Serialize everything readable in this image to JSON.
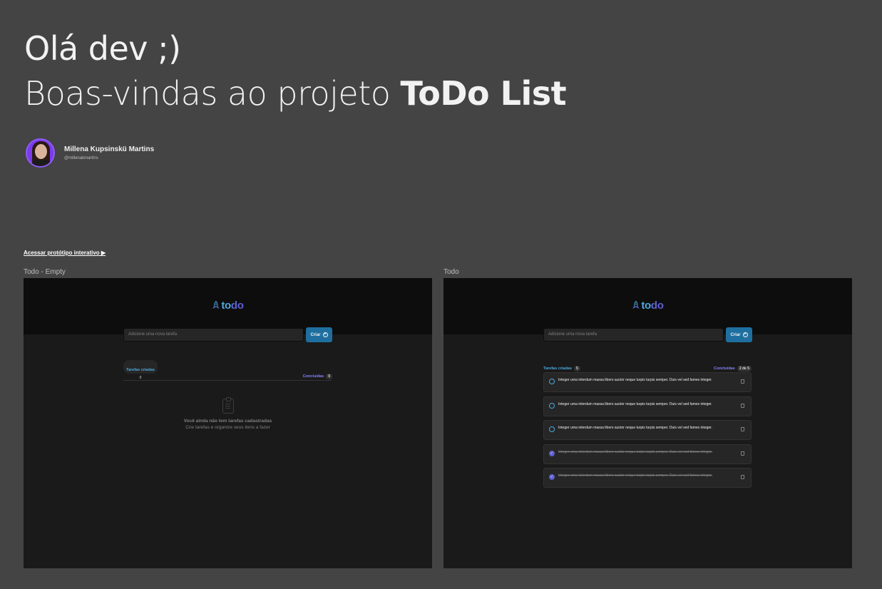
{
  "header": {
    "greeting": "Olá dev ;)",
    "welcome_prefix": "Boas-vindas ao projeto",
    "welcome_project": "ToDo List"
  },
  "author": {
    "name": "Millena Kupsinskü Martins",
    "handle": "@millenakmartins"
  },
  "prototype_link": "Acessar protótipo interativo ▶",
  "frames": {
    "empty": {
      "label": "Todo - Empty",
      "logo_to": "to",
      "logo_do": "do",
      "input_placeholder": "Adicione uma nova tarefa",
      "create_label": "Criar",
      "created_label": "Tarefas criadas",
      "created_count": "0",
      "done_label": "Concluídas",
      "done_count": "0",
      "empty_title": "Você ainda não tem tarefas cadastradas",
      "empty_subtitle": "Crie tarefas e organize seus itens a fazer"
    },
    "list": {
      "label": "Todo",
      "logo_to": "to",
      "logo_do": "do",
      "input_placeholder": "Adicione uma nova tarefa",
      "create_label": "Criar",
      "created_label": "Tarefas criadas",
      "created_count": "5",
      "done_label": "Concluídas",
      "done_count": "2 de 5",
      "tasks": [
        {
          "text": "Integer urna interdum massa libero auctor neque turpis turpis semper. Duis vel sed fames integer.",
          "done": false
        },
        {
          "text": "Integer urna interdum massa libero auctor neque turpis turpis semper. Duis vel sed fames integer.",
          "done": false
        },
        {
          "text": "Integer urna interdum massa libero auctor neque turpis turpis semper. Duis vel sed fames integer.",
          "done": false
        },
        {
          "text": "Integer urna interdum massa libero auctor neque turpis turpis semper. Duis vel sed fames integer.",
          "done": true
        },
        {
          "text": "Integer urna interdum massa libero auctor neque turpis turpis semper. Duis vel sed fames integer.",
          "done": true
        }
      ]
    }
  },
  "colors": {
    "page_bg": "#444444",
    "app_bg": "#1a1a1a",
    "header_bg": "#0d0d0d",
    "blue": "#4ea8de",
    "purple": "#5e60ce",
    "button": "#1e6f9f"
  },
  "icons": [
    "rocket-icon",
    "plus-circle-icon",
    "clipboard-icon",
    "trash-icon",
    "check-icon",
    "circle-icon"
  ]
}
